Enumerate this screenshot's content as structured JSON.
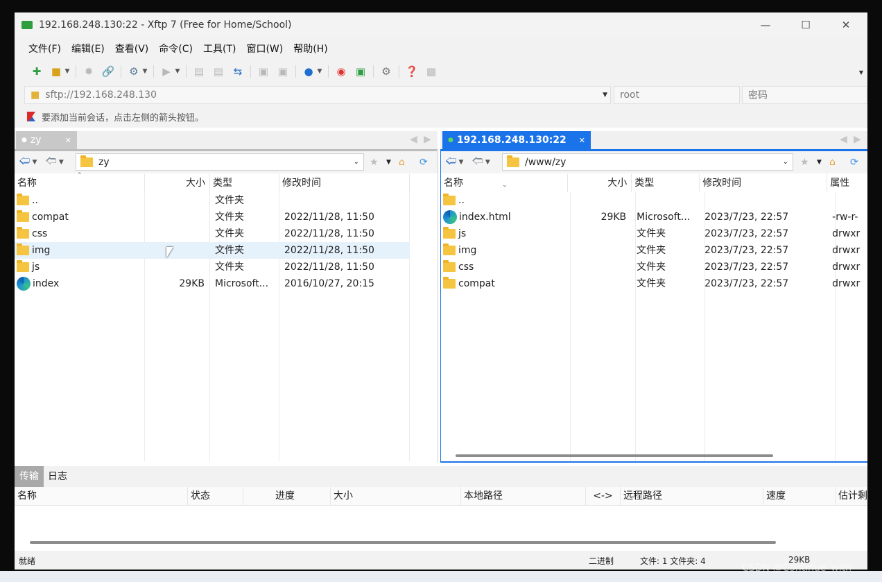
{
  "window": {
    "title": "192.168.248.130:22 - Xftp 7 (Free for Home/School)"
  },
  "menu": [
    "文件(F)",
    "编辑(E)",
    "查看(V)",
    "命令(C)",
    "工具(T)",
    "窗口(W)",
    "帮助(H)"
  ],
  "address": {
    "url": "sftp://192.168.248.130",
    "user": "root",
    "password_placeholder": "密码"
  },
  "hint": "要添加当前会话，点击左侧的箭头按钮。",
  "left": {
    "tab": "zy",
    "path": "zy",
    "columns": [
      "名称",
      "大小",
      "类型",
      "修改时间"
    ],
    "rows": [
      {
        "name": "..",
        "size": "",
        "type": "文件夹",
        "mtime": "",
        "icon": "folder-icon"
      },
      {
        "name": "compat",
        "size": "",
        "type": "文件夹",
        "mtime": "2022/11/28, 11:50",
        "icon": "folder-icon"
      },
      {
        "name": "css",
        "size": "",
        "type": "文件夹",
        "mtime": "2022/11/28, 11:50",
        "icon": "folder-icon"
      },
      {
        "name": "img",
        "size": "",
        "type": "文件夹",
        "mtime": "2022/11/28, 11:50",
        "icon": "folder-icon"
      },
      {
        "name": "js",
        "size": "",
        "type": "文件夹",
        "mtime": "2022/11/28, 11:50",
        "icon": "folder-icon"
      },
      {
        "name": "index",
        "size": "29KB",
        "type": "Microsoft...",
        "mtime": "2016/10/27, 20:15",
        "icon": "edge-icon"
      }
    ],
    "selected_row": 3
  },
  "right": {
    "tab": "192.168.248.130:22",
    "path": "/www/zy",
    "columns": [
      "名称",
      "大小",
      "类型",
      "修改时间",
      "属性"
    ],
    "rows": [
      {
        "name": "..",
        "size": "",
        "type": "",
        "mtime": "",
        "attr": "",
        "icon": "folder-icon"
      },
      {
        "name": "index.html",
        "size": "29KB",
        "type": "Microsoft...",
        "mtime": "2023/7/23, 22:57",
        "attr": "-rw-r-",
        "icon": "edge-icon"
      },
      {
        "name": "js",
        "size": "",
        "type": "文件夹",
        "mtime": "2023/7/23, 22:57",
        "attr": "drwxr",
        "icon": "folder-icon"
      },
      {
        "name": "img",
        "size": "",
        "type": "文件夹",
        "mtime": "2023/7/23, 22:57",
        "attr": "drwxr",
        "icon": "folder-icon"
      },
      {
        "name": "css",
        "size": "",
        "type": "文件夹",
        "mtime": "2023/7/23, 22:57",
        "attr": "drwxr",
        "icon": "folder-icon"
      },
      {
        "name": "compat",
        "size": "",
        "type": "文件夹",
        "mtime": "2023/7/23, 22:57",
        "attr": "drwxr",
        "icon": "folder-icon"
      }
    ]
  },
  "transfer": {
    "tabs": [
      "传输",
      "日志"
    ],
    "columns": [
      "名称",
      "状态",
      "进度",
      "大小",
      "本地路径",
      "<->",
      "远程路径",
      "速度",
      "估计剩"
    ]
  },
  "status": {
    "ready": "就绪",
    "mode": "二进制",
    "counts": "文件: 1  文件夹: 4",
    "size": "29KB"
  },
  "watermark": "CSDN @Continue_with",
  "colors": {
    "accent": "#1a73e8",
    "selection": "#e5f1fb",
    "folder": "#f5c542"
  }
}
